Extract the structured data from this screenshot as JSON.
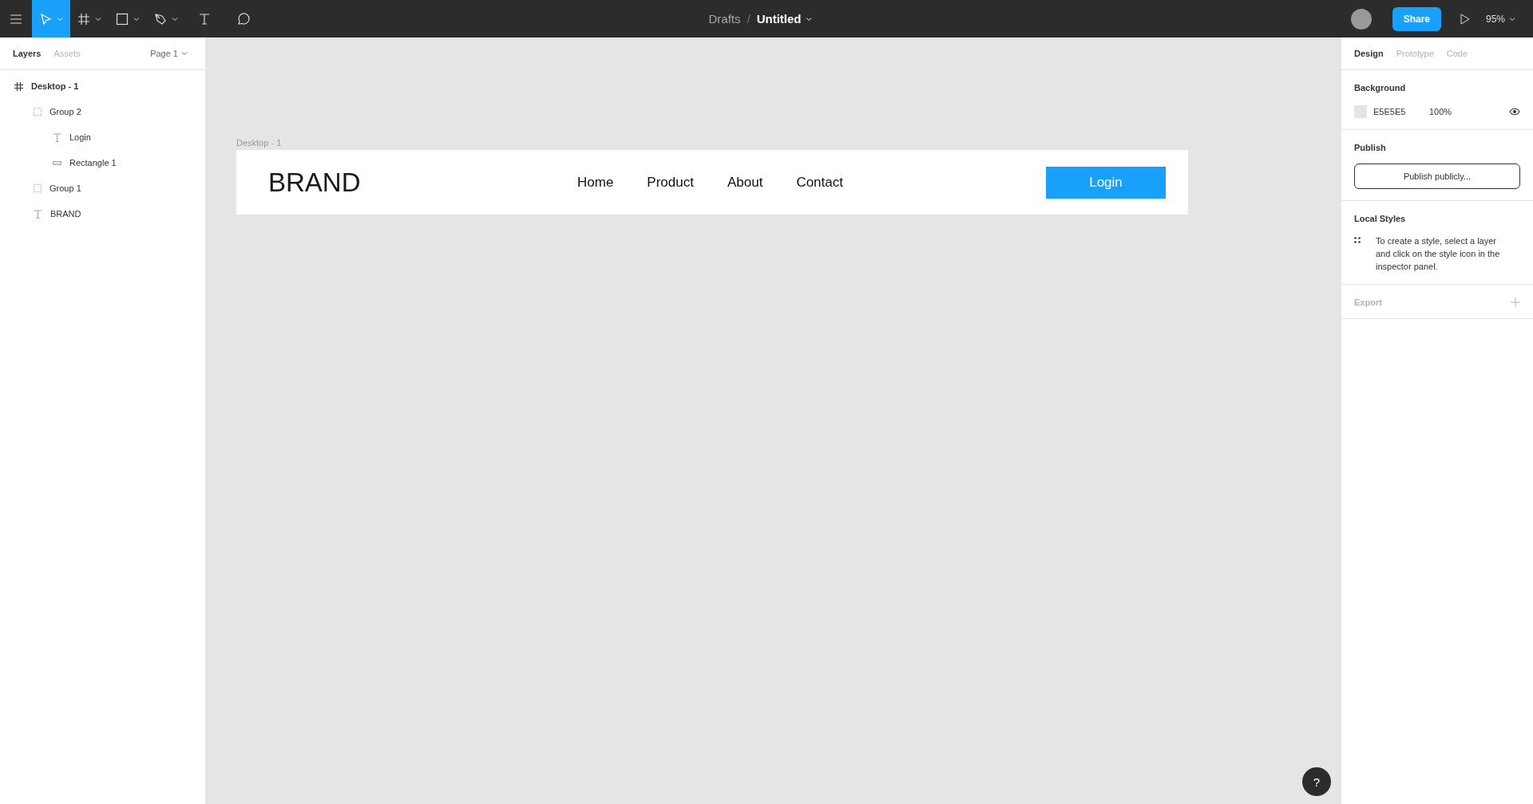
{
  "toolbar": {
    "tools": [
      {
        "kind": "move",
        "selected": true,
        "dropdown": true
      },
      {
        "kind": "frame",
        "selected": false,
        "dropdown": true
      },
      {
        "kind": "rectangle",
        "selected": false,
        "dropdown": true
      },
      {
        "kind": "pen",
        "selected": false,
        "dropdown": true
      },
      {
        "kind": "text",
        "selected": false,
        "dropdown": false
      },
      {
        "kind": "comment",
        "selected": false,
        "dropdown": false
      }
    ],
    "breadcrumb": "Drafts",
    "separator": "/",
    "file_name": "Untitled",
    "share": "Share",
    "zoom": "95%"
  },
  "left_panel": {
    "tabs": [
      {
        "label": "Layers",
        "selected": true
      },
      {
        "label": "Assets",
        "selected": false
      }
    ],
    "page": "Page 1",
    "layers": [
      {
        "kind": "frame",
        "name": "Desktop - 1",
        "children": [
          {
            "kind": "group",
            "name": "Group 2",
            "children": [
              {
                "kind": "text",
                "name": "Login"
              },
              {
                "kind": "rectangle",
                "name": "Rectangle 1"
              }
            ]
          },
          {
            "kind": "group",
            "name": "Group 1"
          },
          {
            "kind": "text",
            "name": "BRAND"
          }
        ]
      }
    ]
  },
  "canvas": {
    "frame_label": "Desktop - 1",
    "brand": "BRAND",
    "nav": [
      "Home",
      "Product",
      "About",
      "Contact"
    ],
    "login": "Login"
  },
  "right_panel": {
    "tabs": [
      {
        "label": "Design",
        "selected": true
      },
      {
        "label": "Prototype",
        "selected": false
      },
      {
        "label": "Code",
        "selected": false
      }
    ],
    "background": {
      "title": "Background",
      "color": "#e5e5e5",
      "hex": "E5E5E5",
      "opacity": "100%"
    },
    "publish": {
      "title": "Publish",
      "button": "Publish publicly..."
    },
    "local_styles": {
      "title": "Local Styles",
      "hint": "To create a style, select a layer and click on the style icon in the inspector panel."
    },
    "export": {
      "title": "Export"
    }
  },
  "help": "?"
}
